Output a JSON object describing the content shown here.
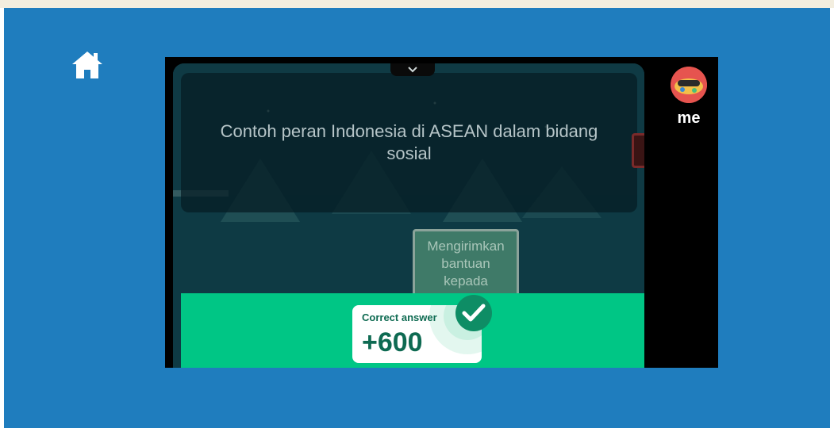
{
  "nav": {
    "home_icon": "home-icon"
  },
  "game": {
    "question": "Contoh peran Indonesia di ASEAN dalam bidang sosial",
    "collapse_icon": "chevron-down-icon",
    "answer_option": {
      "lines": [
        "Mengirimkan",
        "bantuan",
        "kepada"
      ]
    },
    "result": {
      "label": "Correct answer",
      "points": "+600",
      "icon": "check-icon"
    }
  },
  "player": {
    "name": "me",
    "avatar_icon": "avatar"
  },
  "colors": {
    "background": "#1f7dbe",
    "result_band": "#00c685",
    "game_bg": "#0f3a44"
  }
}
